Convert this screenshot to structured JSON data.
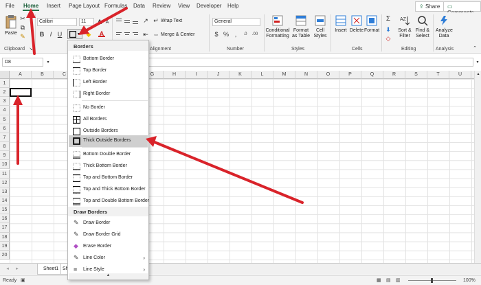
{
  "menu_tabs": [
    "File",
    "Home",
    "Insert",
    "Page Layout",
    "Formulas",
    "Data",
    "Review",
    "View",
    "Developer",
    "Help"
  ],
  "active_tab": "Home",
  "share_label": "Share",
  "comments_label": "Comments",
  "ribbon": {
    "paste_label": "Paste",
    "clipboard_label": "Clipboard",
    "font_name": "Calibri",
    "font_size": "11",
    "bold": "B",
    "italic": "I",
    "underline": "U",
    "font_color_glyph": "A",
    "wrap_text_label": "Wrap Text",
    "merge_center_label": "Merge & Center",
    "alignment_label": "Alignment",
    "number_format": "General",
    "number_label": "Number",
    "conditional_formatting_label": "Conditional Formatting",
    "format_as_table_label": "Format as Table",
    "cell_styles_label": "Cell Styles",
    "styles_label": "Styles",
    "insert_label": "Insert",
    "delete_label": "Delete",
    "format_label": "Format",
    "cells_label": "Cells",
    "sort_filter_label": "Sort & Filter",
    "find_select_label": "Find & Select",
    "editing_label": "Editing",
    "analyze_data_label": "Analyze Data",
    "analysis_label": "Analysis",
    "sigma_glyph": "Σ"
  },
  "name_box": "D8",
  "columns": [
    "A",
    "B",
    "C",
    "D",
    "E",
    "F",
    "G",
    "H",
    "I",
    "J",
    "K",
    "L",
    "M",
    "N",
    "O",
    "P",
    "Q",
    "R",
    "S",
    "T",
    "U",
    "V"
  ],
  "rows": [
    "1",
    "2",
    "3",
    "4",
    "5",
    "6",
    "7",
    "8",
    "9",
    "10",
    "11",
    "12",
    "13",
    "14",
    "15",
    "16",
    "17",
    "18",
    "19",
    "20"
  ],
  "sheet_tab": "Sheet1",
  "sheet_tab_partial": "Sh",
  "status_ready": "Ready",
  "zoom_text": "100%",
  "borders_menu": {
    "header": "Borders",
    "items": [
      "Bottom Border",
      "Top Border",
      "Left Border",
      "Right Border",
      "No Border",
      "All Borders",
      "Outside Borders",
      "Thick Outside Borders",
      "Bottom Double Border",
      "Thick Bottom Border",
      "Top and Bottom Border",
      "Top and Thick Bottom Border",
      "Top and Double Bottom Border"
    ],
    "draw_header": "Draw Borders",
    "draw_items": [
      "Draw Border",
      "Draw Border Grid",
      "Erase Border",
      "Line Color",
      "Line Style"
    ],
    "more_glyph": "▲"
  },
  "highlighted_item": "Thick Outside Borders",
  "accent_color": "#217346",
  "arrow_color": "#d9232a"
}
